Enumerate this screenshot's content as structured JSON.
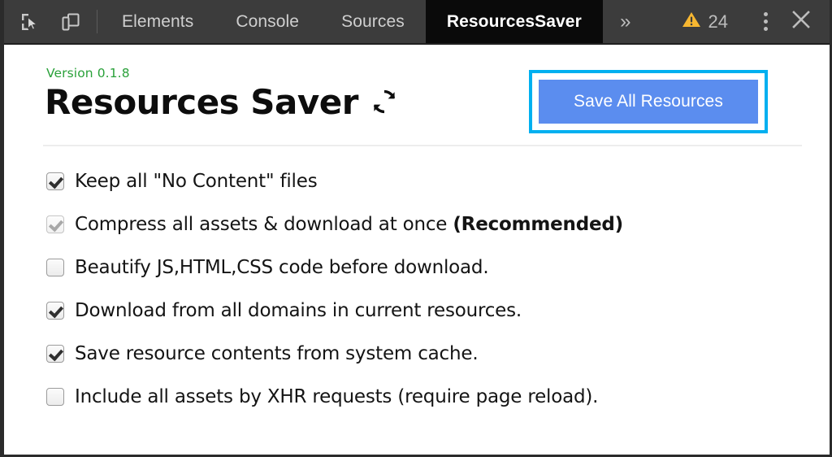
{
  "devtools": {
    "left_icons": [
      {
        "name": "inspect-element-icon",
        "label": "Inspect element"
      },
      {
        "name": "device-toolbar-icon",
        "label": "Toggle device toolbar"
      }
    ],
    "tabs": [
      {
        "label": "Elements",
        "active": false
      },
      {
        "label": "Console",
        "active": false
      },
      {
        "label": "Sources",
        "active": false
      },
      {
        "label": "ResourcesSaver",
        "active": true
      }
    ],
    "overflow_label": "»",
    "warnings": {
      "icon": "warning-triangle-icon",
      "count": "24",
      "color": "#f7b731"
    },
    "more_menu_label": "Customize and control DevTools",
    "close_label": "Close DevTools"
  },
  "panel": {
    "version": "Version 0.1.8",
    "title": "Resources Saver",
    "refresh_icon": "refresh-icon",
    "save_button": {
      "label": "Save All Resources",
      "color": "#5b8def",
      "highlight_color": "#00b0f0"
    },
    "options": [
      {
        "label": "Keep all \"No Content\" files",
        "bold_suffix": "",
        "checked": true,
        "disabled": false,
        "name": "option-keep-no-content-files"
      },
      {
        "label": "Compress all assets & download at once ",
        "bold_suffix": "(Recommended)",
        "checked": true,
        "disabled": true,
        "name": "option-compress-all-assets"
      },
      {
        "label": "Beautify JS,HTML,CSS code before download.",
        "bold_suffix": "",
        "checked": false,
        "disabled": false,
        "name": "option-beautify-code"
      },
      {
        "label": "Download from all domains in current resources.",
        "bold_suffix": "",
        "checked": true,
        "disabled": false,
        "name": "option-download-all-domains"
      },
      {
        "label": "Save resource contents from system cache.",
        "bold_suffix": "",
        "checked": true,
        "disabled": false,
        "name": "option-save-from-system-cache"
      },
      {
        "label": "Include all assets by XHR requests (require page reload).",
        "bold_suffix": "",
        "checked": false,
        "disabled": false,
        "name": "option-include-xhr-assets"
      }
    ]
  }
}
